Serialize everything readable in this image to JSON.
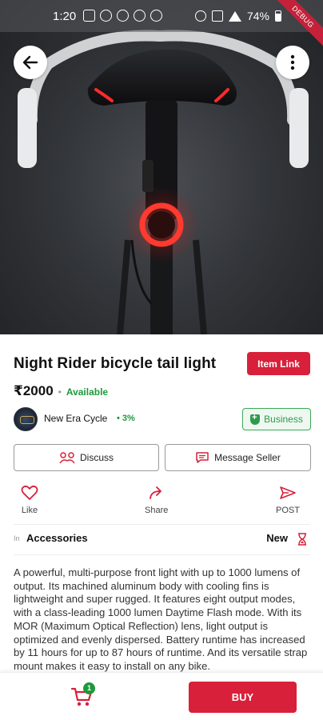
{
  "status_bar": {
    "time": "1:20",
    "battery": "74%",
    "debug_label": "DEBUG"
  },
  "product": {
    "title": "Night Rider bicycle tail light",
    "item_link_label": "Item Link",
    "price": "₹2000",
    "availability": "Available",
    "seller": {
      "name": "New Era Cycle",
      "rating": "3%",
      "badge": "Business"
    },
    "actions": {
      "discuss": "Discuss",
      "message_seller": "Message Seller"
    },
    "social": {
      "like": "Like",
      "share": "Share",
      "post": "POST"
    },
    "category_prefix": "In",
    "category": "Accessories",
    "condition": "New",
    "description": "A powerful, multi-purpose front light with up to 1000 lumens of output. Its machined aluminum body with cooling fins is lightweight and super rugged. It features eight output modes, with a class-leading 1000 lumen Daytime Flash mode. With its MOR (Maximum Optical Reflection) lens, light output is optimized and evenly dispersed. Battery runtime has increased by 11 hours for up to 87 hours of runtime. And its versatile strap mount makes it easy to install on any bike."
  },
  "bottom_bar": {
    "cart_count": "1",
    "buy_label": "BUY"
  },
  "colors": {
    "brand_red": "#d8203a",
    "available_green": "#1b9a3a",
    "tail_light_red": "#ff2a2a"
  }
}
